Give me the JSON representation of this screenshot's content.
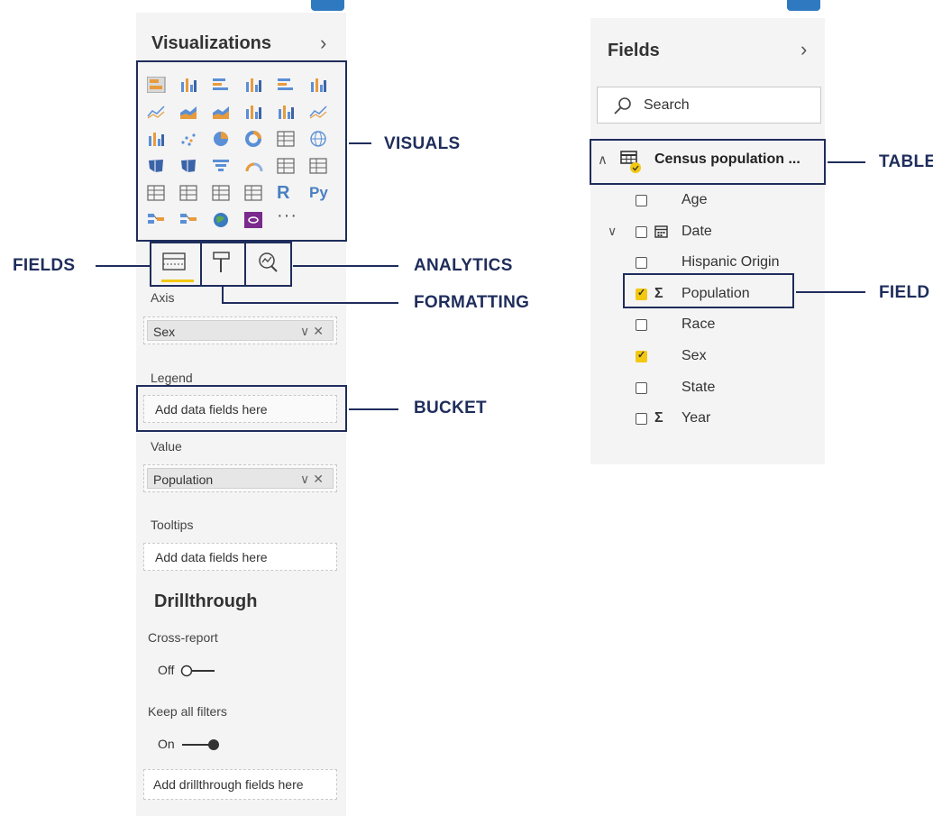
{
  "visualizations_pane": {
    "title": "Visualizations",
    "expand_icon": "chevron-right-icon",
    "more_icon_text": "···",
    "r_visual_text": "R",
    "python_visual_text": "Py",
    "tabs": [
      {
        "name": "fields-tab",
        "icon": "fields-icon",
        "selected": true
      },
      {
        "name": "format-tab",
        "icon": "paint-roller-icon",
        "selected": false
      },
      {
        "name": "analytics-tab",
        "icon": "magnifier-chart-icon",
        "selected": false
      }
    ],
    "wells": {
      "axis": {
        "label": "Axis",
        "value": "Sex"
      },
      "legend": {
        "label": "Legend",
        "placeholder": "Add data fields here"
      },
      "value": {
        "label": "Value",
        "value": "Population"
      },
      "tooltips": {
        "label": "Tooltips",
        "placeholder": "Add data fields here"
      }
    },
    "chip_controls": "∨✕",
    "drillthrough": {
      "title": "Drillthrough",
      "cross_report": {
        "label": "Cross-report",
        "state": "Off"
      },
      "keep_all_filters": {
        "label": "Keep all filters",
        "state": "On"
      },
      "placeholder": "Add drillthrough fields here"
    }
  },
  "fields_pane": {
    "title": "Fields",
    "expand_icon": "chevron-right-icon",
    "search_placeholder": "Search",
    "table": {
      "name": "Census population ...",
      "expanded": true
    },
    "fields": [
      {
        "label": "Age",
        "checked": false,
        "sigma": false,
        "calendar": false
      },
      {
        "label": "Date",
        "checked": false,
        "sigma": false,
        "calendar": true
      },
      {
        "label": "Hispanic Origin",
        "checked": false,
        "sigma": false,
        "calendar": false
      },
      {
        "label": "Population",
        "checked": true,
        "sigma": true,
        "calendar": false
      },
      {
        "label": "Race",
        "checked": false,
        "sigma": false,
        "calendar": false
      },
      {
        "label": "Sex",
        "checked": true,
        "sigma": false,
        "calendar": false
      },
      {
        "label": "State",
        "checked": false,
        "sigma": false,
        "calendar": false
      },
      {
        "label": "Year",
        "checked": false,
        "sigma": true,
        "calendar": false
      }
    ]
  },
  "annotations": {
    "visuals": "VISUALS",
    "fields": "FIELDS",
    "analytics": "ANALYTICS",
    "formatting": "FORMATTING",
    "bucket": "BUCKET",
    "table": "TABLE",
    "field": "FIELD"
  },
  "colors": {
    "annotation_navy": "#1f2d5c",
    "accent_yellow": "#f2c811",
    "tab_blue": "#2e79c0"
  }
}
